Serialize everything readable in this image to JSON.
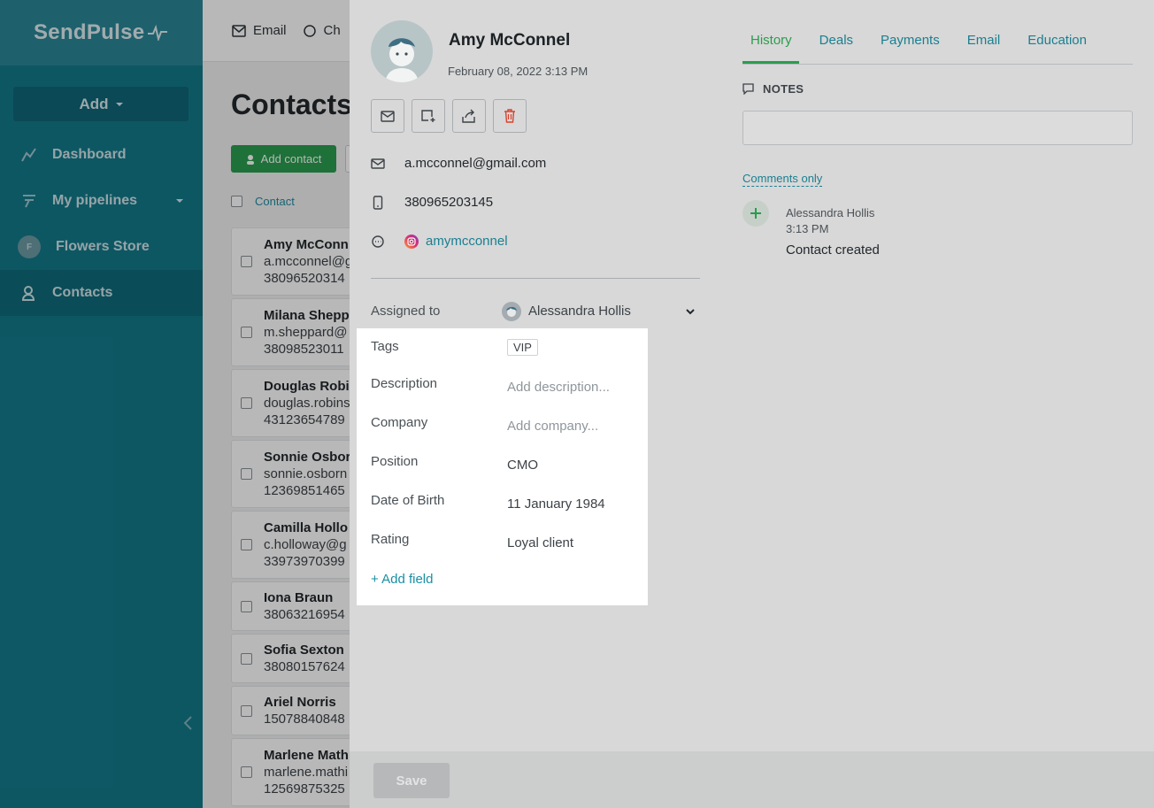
{
  "sidebar": {
    "logo": "SendPulse",
    "add_label": "Add",
    "items": [
      {
        "label": "Dashboard",
        "icon": "chart-line-icon"
      },
      {
        "label": "My pipelines",
        "icon": "pipeline-icon"
      },
      {
        "label": "Flowers Store",
        "icon": "avatar",
        "avatar_letter": "F"
      },
      {
        "label": "Contacts",
        "icon": "contacts-icon"
      }
    ]
  },
  "topbar": {
    "items": [
      {
        "label": "Email",
        "icon": "envelope-icon"
      },
      {
        "label": "Ch",
        "icon": "chat-icon"
      }
    ]
  },
  "contacts_page": {
    "title": "Contacts",
    "add_contact_label": "Add contact",
    "column_contact": "Contact",
    "rows": [
      {
        "name": "Amy McConn",
        "line1": "a.mcconnel@g",
        "line2": "38096520314"
      },
      {
        "name": "Milana Shepp",
        "line1": "m.sheppard@",
        "line2": "38098523011"
      },
      {
        "name": "Douglas Robi",
        "line1": "douglas.robins",
        "line2": "43123654789"
      },
      {
        "name": "Sonnie Osbor",
        "line1": "sonnie.osborn",
        "line2": "12369851465"
      },
      {
        "name": "Camilla Hollo",
        "line1": "c.holloway@g",
        "line2": "33973970399"
      },
      {
        "name": "Iona Braun",
        "line1": "38063216954",
        "line2": ""
      },
      {
        "name": "Sofia Sexton",
        "line1": "38080157624",
        "line2": ""
      },
      {
        "name": "Ariel Norris",
        "line1": "15078840848",
        "line2": ""
      },
      {
        "name": "Marlene Math",
        "line1": "marlene.mathi",
        "line2": "12569875325"
      }
    ]
  },
  "contact": {
    "name": "Amy McConnel",
    "created": "February 08, 2022 3:13 PM",
    "email": "a.mcconnel@gmail.com",
    "phone": "380965203145",
    "instagram": "amymcconnel",
    "assigned_label": "Assigned to",
    "assigned_to": "Alessandra Hollis",
    "fields": [
      {
        "label": "Tags",
        "value": "VIP",
        "kind": "tag"
      },
      {
        "label": "Description",
        "value": "Add description...",
        "kind": "placeholder"
      },
      {
        "label": "Company",
        "value": "Add company...",
        "kind": "placeholder"
      },
      {
        "label": "Position",
        "value": "CMO",
        "kind": "text"
      },
      {
        "label": "Date of Birth",
        "value": "11 January 1984",
        "kind": "text"
      },
      {
        "label": "Rating",
        "value": "Loyal client",
        "kind": "text"
      }
    ],
    "add_field_label": "+ Add field",
    "save_label": "Save"
  },
  "history_panel": {
    "tabs": [
      "History",
      "Deals",
      "Payments",
      "Email",
      "Education"
    ],
    "active_tab": "History",
    "notes_label": "NOTES",
    "comments_only_label": "Comments only",
    "entries": [
      {
        "author": "Alessandra Hollis",
        "time": "3:13 PM",
        "event": "Contact created"
      }
    ]
  },
  "colors": {
    "sidebar": "#13798a",
    "accent_green": "#2a9d4e",
    "link_teal": "#1a7f91",
    "delete_red": "#d9432f"
  }
}
